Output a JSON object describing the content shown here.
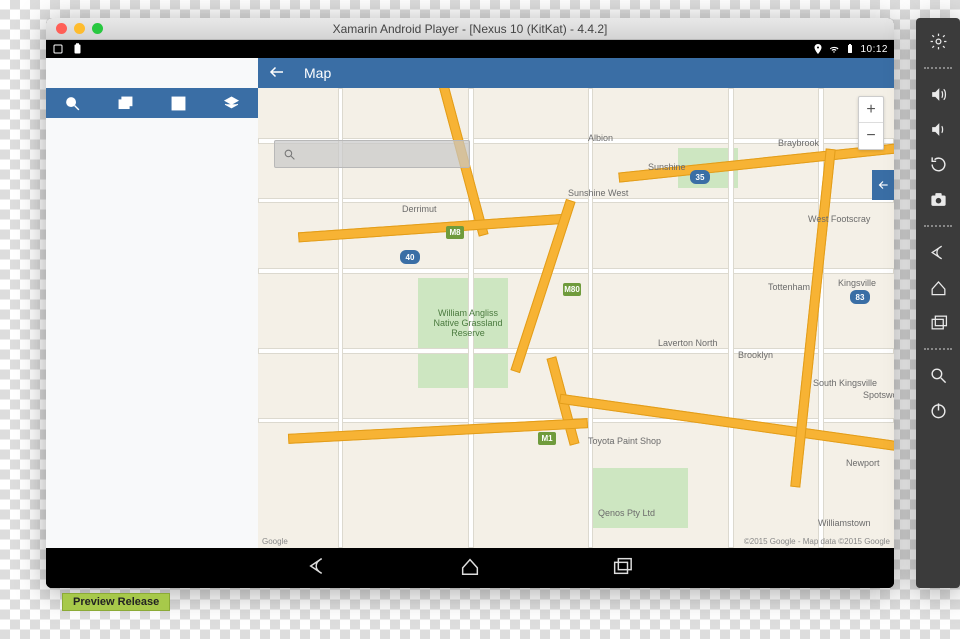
{
  "window": {
    "title": "Xamarin Android Player - [Nexus 10 (KitKat) - 4.4.2]"
  },
  "statusbar": {
    "time": "10:12"
  },
  "app": {
    "title": "Map",
    "back_label": "Back"
  },
  "left_tabs": {
    "search": "search-icon",
    "layers": "stacks-icon",
    "grid": "grid-icon",
    "cube": "cube-icon"
  },
  "map": {
    "zoom_in": "+",
    "zoom_out": "−",
    "search_placeholder": "",
    "attribution_left": "Google",
    "attribution_right": "©2015 Google - Map data ©2015 Google",
    "labels": {
      "sunshine": "Sunshine",
      "sunshine_west": "Sunshine West",
      "albion": "Albion",
      "derrimut": "Derrimut",
      "braybrook": "Braybrook",
      "tottenham": "Tottenham",
      "kingsville": "Kingsville",
      "brooklyn": "Brooklyn",
      "laverton_north": "Laverton North",
      "west_footscray": "West Footscray",
      "south_kingsville": "South Kingsville",
      "spotswood": "Spotswood",
      "newport": "Newport",
      "williamstown": "Williamstown",
      "grassland": "William Angliss Native Grassland Reserve",
      "toyota": "Toyota Paint Shop",
      "qenos": "Qenos Pty Ltd"
    },
    "routes": {
      "m8": "M8",
      "m80": "M80",
      "m1": "M1",
      "r40": "40",
      "r35": "35",
      "r83": "83"
    }
  },
  "preview_badge": "Preview Release",
  "emulator_sidebar": {
    "settings": "gear-icon",
    "vol_up": "volume-up-icon",
    "vol_down": "volume-down-icon",
    "rotate": "rotate-ccw-icon",
    "camera": "camera-icon",
    "back": "android-back-icon",
    "home": "android-home-icon",
    "recents": "android-recents-icon",
    "search": "search-icon",
    "power": "power-icon"
  },
  "navbar": {
    "back": "android-back-icon",
    "home": "android-home-icon",
    "recents": "android-recents-icon"
  }
}
